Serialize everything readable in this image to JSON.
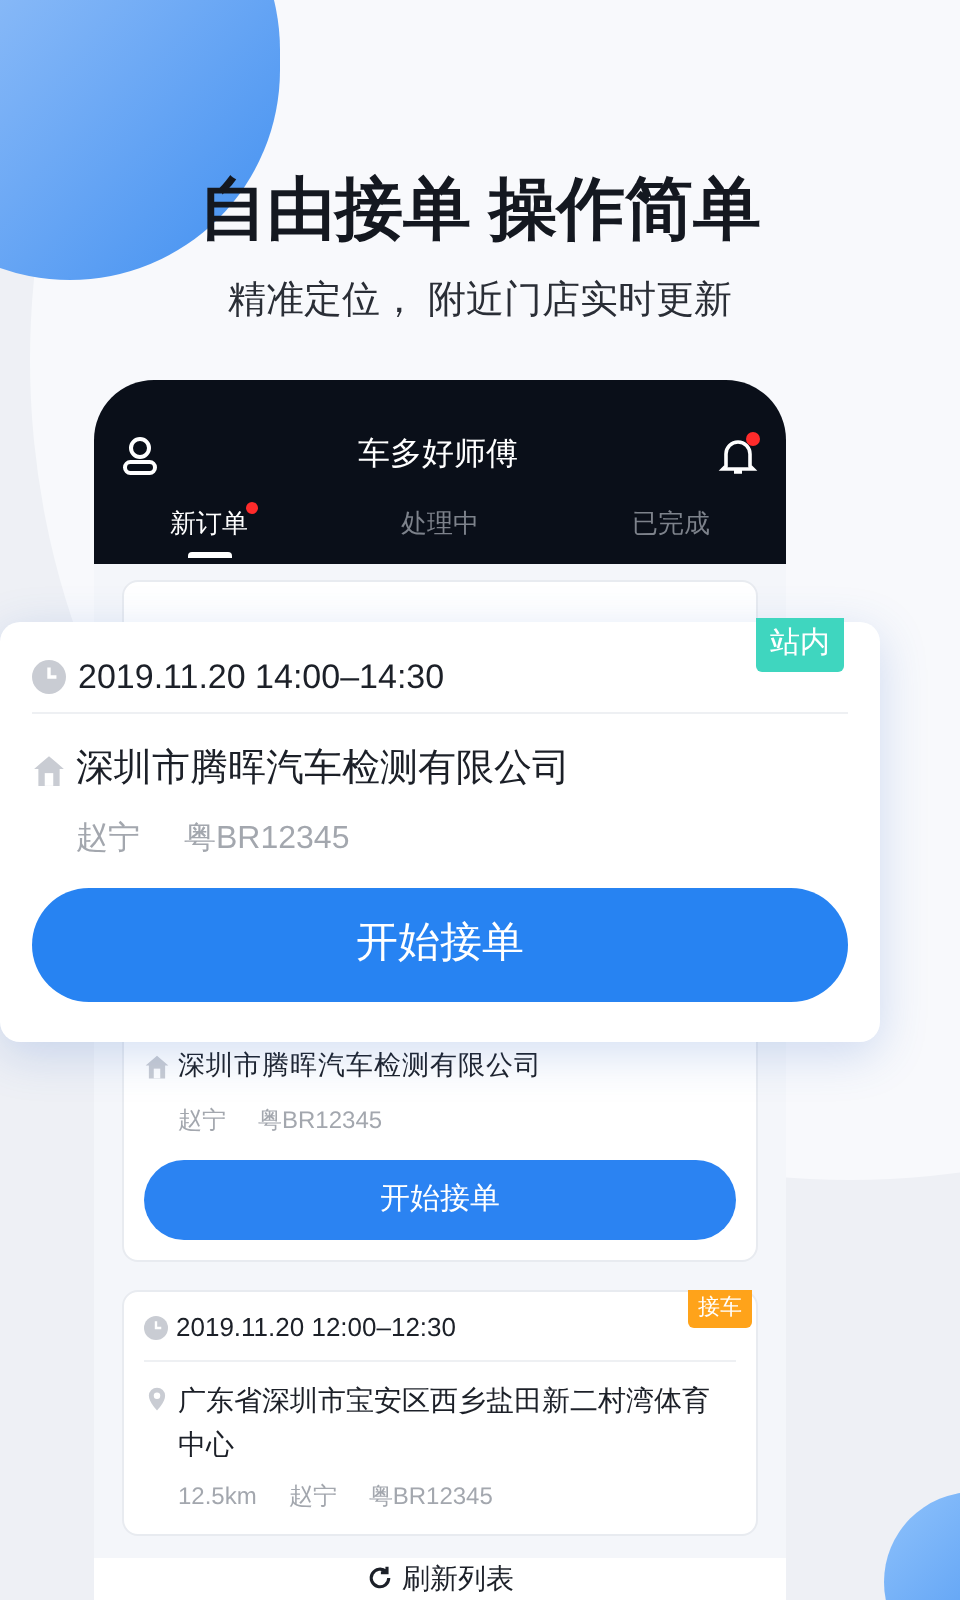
{
  "headline": "自由接单 操作简单",
  "subheadline": "精准定位， 附近门店实时更新",
  "app": {
    "title": "车多好师傅",
    "notification_badge": true,
    "tabs": [
      {
        "label": "新订单",
        "selected": true,
        "badge": true
      },
      {
        "label": "处理中",
        "selected": false,
        "badge": false
      },
      {
        "label": "已完成",
        "selected": false,
        "badge": false
      }
    ]
  },
  "featured_order": {
    "time": "2019.11.20 14:00–14:30",
    "tag": "站内",
    "color": "#3fd6bf",
    "kind": "shop",
    "place": "深圳市腾晖汽车检测有限公司",
    "meta": [
      "赵宁",
      "粤BR12345"
    ],
    "button": "开始接单"
  },
  "orders": [
    {
      "kind": "shop",
      "place": "深圳市腾晖汽车检测有限公司",
      "meta": [
        "赵宁",
        "粤BR12345"
      ],
      "button": "开始接单"
    },
    {
      "time": "2019.11.20 12:00–12:30",
      "tag": "接车",
      "color": "#ffa31a",
      "kind": "location",
      "place": "广东省深圳市宝安区西乡盐田新二村湾体育中心",
      "meta": [
        "12.5km",
        "赵宁",
        "粤BR12345"
      ]
    }
  ],
  "refresh_label": "刷新列表"
}
